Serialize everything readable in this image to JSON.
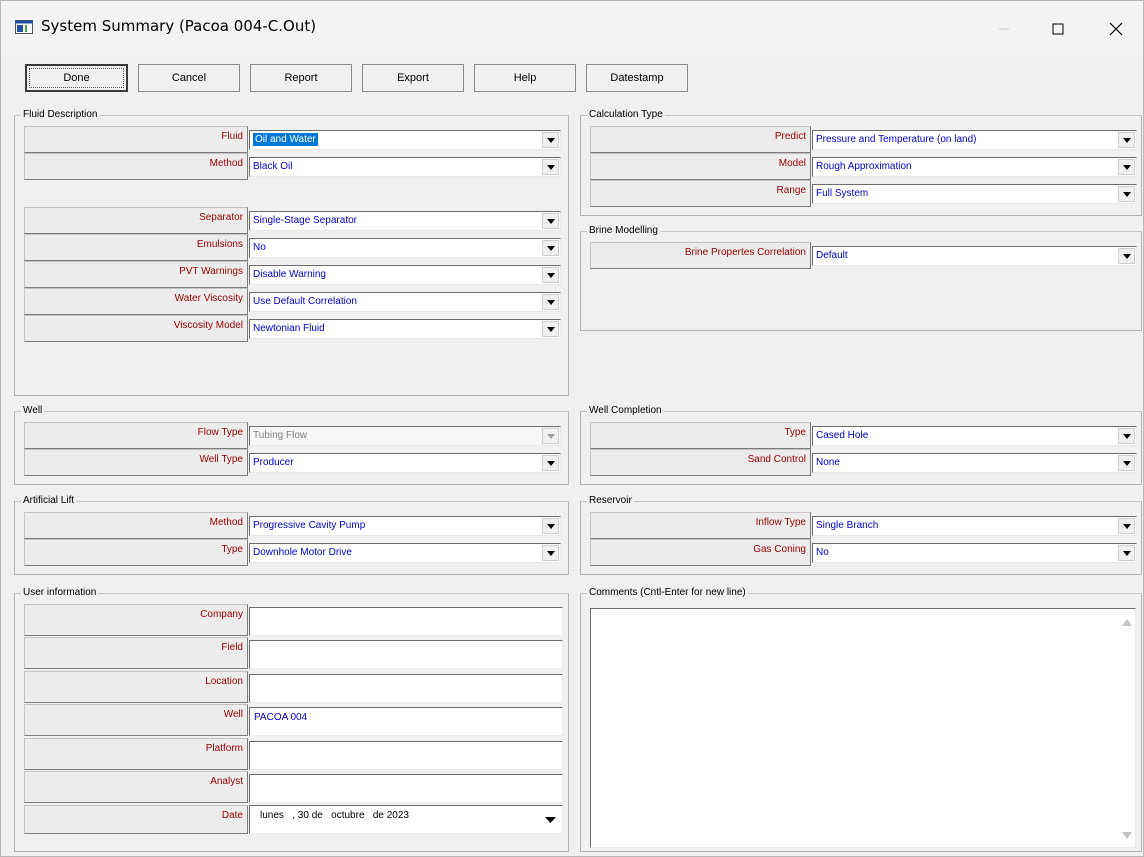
{
  "window": {
    "title": "System Summary (Pacoa 004-C.Out)"
  },
  "toolbar": {
    "done": "Done",
    "cancel": "Cancel",
    "report": "Report",
    "export": "Export",
    "help": "Help",
    "datestamp": "Datestamp"
  },
  "fluid_description": {
    "title": "Fluid Description",
    "fluid": {
      "label": "Fluid",
      "value": "Oil and Water"
    },
    "method": {
      "label": "Method",
      "value": "Black Oil"
    },
    "separator": {
      "label": "Separator",
      "value": "Single-Stage Separator"
    },
    "emulsions": {
      "label": "Emulsions",
      "value": "No"
    },
    "pvt_warnings": {
      "label": "PVT Warnings",
      "value": "Disable Warning"
    },
    "water_viscosity": {
      "label": "Water Viscosity",
      "value": "Use Default Correlation"
    },
    "viscosity_model": {
      "label": "Viscosity Model",
      "value": "Newtonian Fluid"
    }
  },
  "calculation_type": {
    "title": "Calculation Type",
    "predict": {
      "label": "Predict",
      "value": "Pressure and Temperature (on land)"
    },
    "model": {
      "label": "Model",
      "value": "Rough Approximation"
    },
    "range": {
      "label": "Range",
      "value": "Full System"
    }
  },
  "brine_modelling": {
    "title": "Brine Modelling",
    "correlation": {
      "label": "Brine Propertes Correlation",
      "value": "Default"
    }
  },
  "well": {
    "title": "Well",
    "flow_type": {
      "label": "Flow Type",
      "value": "Tubing Flow"
    },
    "well_type": {
      "label": "Well Type",
      "value": "Producer"
    }
  },
  "well_completion": {
    "title": "Well Completion",
    "type": {
      "label": "Type",
      "value": "Cased Hole"
    },
    "sand_control": {
      "label": "Sand Control",
      "value": "None"
    }
  },
  "artificial_lift": {
    "title": "Artificial Lift",
    "method": {
      "label": "Method",
      "value": "Progressive Cavity Pump"
    },
    "type": {
      "label": "Type",
      "value": "Downhole Motor Drive"
    }
  },
  "reservoir": {
    "title": "Reservoir",
    "inflow_type": {
      "label": "Inflow Type",
      "value": "Single Branch"
    },
    "gas_coning": {
      "label": "Gas Coning",
      "value": "No"
    }
  },
  "user_information": {
    "title": "User information",
    "company": {
      "label": "Company",
      "value": ""
    },
    "field": {
      "label": "Field",
      "value": ""
    },
    "location": {
      "label": "Location",
      "value": ""
    },
    "well": {
      "label": "Well",
      "value": "PACOA 004"
    },
    "platform": {
      "label": "Platform",
      "value": ""
    },
    "analyst": {
      "label": "Analyst",
      "value": ""
    },
    "date": {
      "label": "Date",
      "value": "lunes   , 30 de   octubre   de 2023"
    }
  },
  "comments": {
    "title": "Comments (Cntl-Enter for new line)",
    "value": ""
  },
  "colors": {
    "label_text": "#990000",
    "value_text": "#0000cc",
    "selection": "#0078d7"
  }
}
